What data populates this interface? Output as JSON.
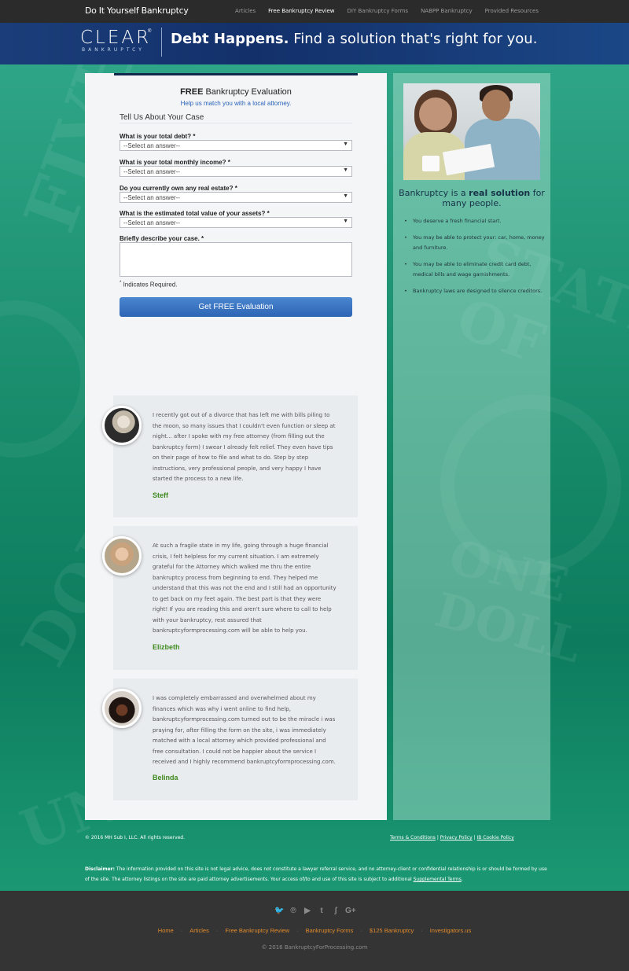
{
  "topbar": {
    "brand": "Do It Yourself Bankruptcy",
    "nav": [
      "Articles",
      "Free Bankruptcy Review",
      "DIY Bankruptcy Forms",
      "NABPP Bankruptcy",
      "Provided Resources"
    ],
    "active_nav": "Free Bankruptcy Review"
  },
  "header": {
    "logo_main": "CLEAR",
    "logo_reg": "®",
    "logo_sub": "BANKRUPTCY",
    "tagline_bold": "Debt Happens.",
    "tagline_rest": " Find a solution that's right for you."
  },
  "form": {
    "title_bold": "FREE",
    "title_rest": " Bankruptcy Evaluation",
    "subtitle": "Help us match you with a local attorney.",
    "section_title": "Tell Us About Your Case",
    "questions": [
      {
        "label": "What is your total debt? *",
        "value": "--Select an answer--"
      },
      {
        "label": "What is your total monthly income? *",
        "value": "--Select an answer--"
      },
      {
        "label": "Do you currently own any real estate? *",
        "value": "--Select an answer--"
      },
      {
        "label": "What is the estimated total value of your assets? *",
        "value": "--Select an answer--"
      }
    ],
    "describe_label": "Briefly describe your case. *",
    "describe_value": "",
    "required_star": "*",
    "required_note": " Indicates Required.",
    "submit_label": "Get FREE Evaluation",
    "select_arrow": "▼"
  },
  "testimonials": [
    {
      "text": "I recently got out of a divorce that has left me with bills piling to the moon, so many issues that I couldn't even function or sleep at night... after I spoke with my free attorney (from filling out the bankruptcy form) I swear I already felt relief. They even have tips on their page of how to file and what to do. Step by step instructions, very professional people, and very happy I have started the process to a new life.",
      "name": "Steff"
    },
    {
      "text": "At such a fragile state in my life, going through a huge financial crisis, I felt helpless for my current situation. I am extremely grateful for the Attorney which walked me thru the entire bankruptcy process from beginning to end. They helped me understand that this was not the end and I still had an opportunity to get back on my feet again. The best part is that they were right! If you are reading this and aren't sure where to call to help with your bankruptcy, rest assured that bankruptcyformprocessing.com will be able to help you.",
      "name": "Elizbeth"
    },
    {
      "text": "I was completely embarrassed and overwhelmed about my finances which was why i went online to find help, bankruptcyformprocessing.com turned out to be the miracle i was praying for, after filling the form on the site, i was immediately matched with a local attorney which provided professional and free consultation. I could not be happier about the service I received and I highly recommend bankruptcyformprocessing.com.",
      "name": "Belinda"
    }
  ],
  "sidebar": {
    "heading_pre": "Bankruptcy is a ",
    "heading_bold": "real solution",
    "heading_post": " for many people.",
    "bullets": [
      "You deserve a fresh financial start.",
      "You may be able to protect your: car, home, money and furniture.",
      "You may be able to eliminate credit card debt, medical bills and wage garnishments.",
      "Bankruptcy laws are designed to silence creditors."
    ]
  },
  "footer": {
    "copyright": "© 2016 MH Sub I, LLC. All rights reserved.",
    "links": [
      "Terms & Conditions",
      "Privacy Policy",
      "IB Cookie Policy"
    ],
    "link_sep": " | ",
    "disclaimer_label": "Disclaimer:",
    "disclaimer_text": " The information provided on this site is not legal advice, does not constitute a lawyer referral service, and no attorney-client or confidential relationship is or should be formed by use of the site. The attorney listings on the site are paid attorney advertisements. Your access of/to and use of this site is subject to additional ",
    "disclaimer_link": "Supplemental Terms",
    "disclaimer_end": ".",
    "social_icons": [
      {
        "name": "twitter-icon",
        "glyph": "🐦"
      },
      {
        "name": "pinterest-icon",
        "glyph": "℗"
      },
      {
        "name": "youtube-icon",
        "glyph": "▶"
      },
      {
        "name": "tumblr-icon",
        "glyph": "t"
      },
      {
        "name": "stumbleupon-icon",
        "glyph": "ʃ"
      },
      {
        "name": "google-plus-icon",
        "glyph": "G+"
      }
    ],
    "bottom_links": [
      "Home",
      "Articles",
      "Free Bankruptcy Review",
      "Bankruptcy Forms",
      "$125 Bankruptcy",
      "Investigators.us"
    ],
    "bottom_sep": "·",
    "bottom_copyright": "© 2016 BankruptcyForProcessing.com"
  },
  "colors": {
    "accent_orange": "#e08b2c",
    "name_green": "#3f8a1f",
    "header_blue": "#13306a",
    "button_blue": "#2d65b4"
  }
}
